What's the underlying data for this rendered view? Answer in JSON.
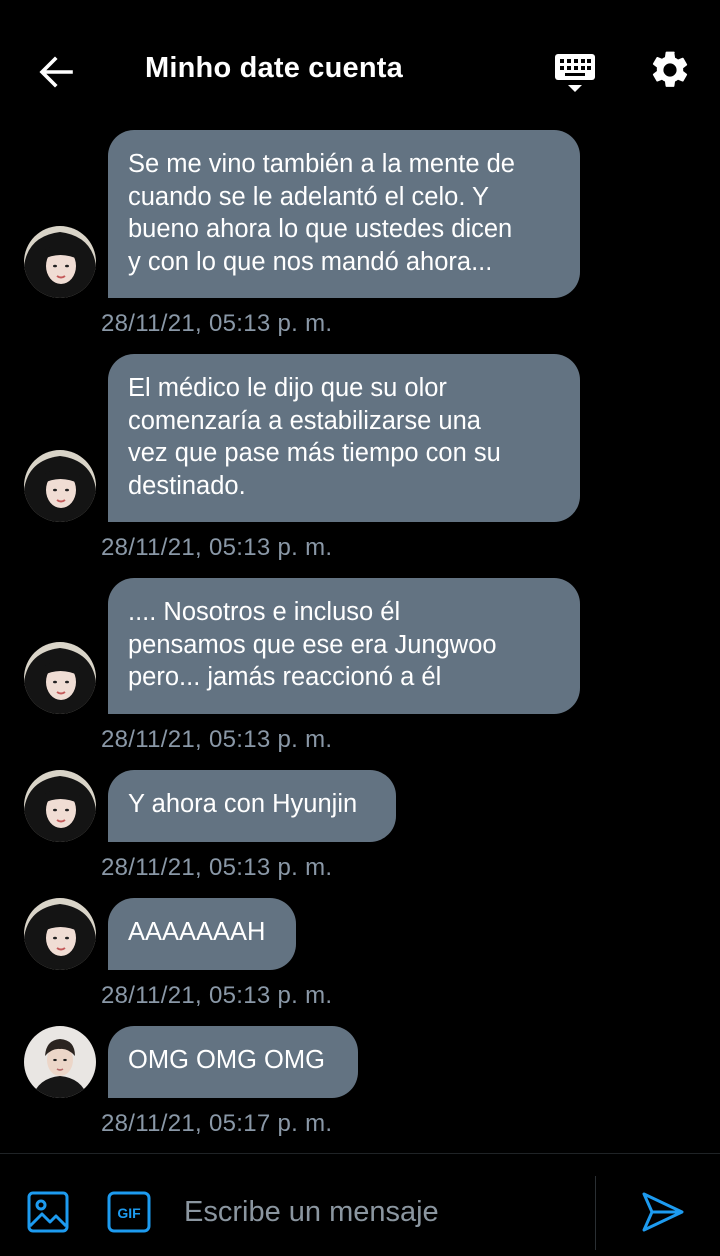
{
  "header": {
    "title": "Minho date cuenta",
    "back_icon": "arrow-left-icon",
    "keyboard_icon": "keyboard-hide-icon",
    "settings_icon": "gear-icon"
  },
  "messages": [
    {
      "text": "Se me vino también a la mente de\ncuando se le adelantó el celo. Y\nbueno ahora lo que ustedes dicen\ny con lo que nos mandó ahora...",
      "time": "28/11/21, 05:13 p. m.",
      "avatar": "avatar-a"
    },
    {
      "text": "El médico le dijo que su olor\ncomenzaría a estabilizarse una\nvez que pase más tiempo con su\ndestinado.",
      "time": "28/11/21, 05:13 p. m.",
      "avatar": "avatar-a"
    },
    {
      "text": ".... Nosotros e incluso él\npensamos que ese era Jungwoo\npero... jamás reaccionó a él",
      "time": "28/11/21, 05:13 p. m.",
      "avatar": "avatar-a"
    },
    {
      "text": "Y ahora con Hyunjin",
      "time": "28/11/21, 05:13 p. m.",
      "avatar": "avatar-a"
    },
    {
      "text": "AAAAAAAH",
      "time": "28/11/21, 05:13 p. m.",
      "avatar": "avatar-a"
    },
    {
      "text": "OMG OMG OMG",
      "time": "28/11/21, 05:17 p. m.",
      "avatar": "avatar-b"
    }
  ],
  "composer": {
    "placeholder": "Escribe un mensaje",
    "gif_label": "GIF",
    "image_icon": "image-icon",
    "send_icon": "send-icon"
  },
  "colors": {
    "background": "#000000",
    "bubble": "#637382",
    "timestamp": "#8a98a7",
    "accent": "#1d9bf0"
  }
}
